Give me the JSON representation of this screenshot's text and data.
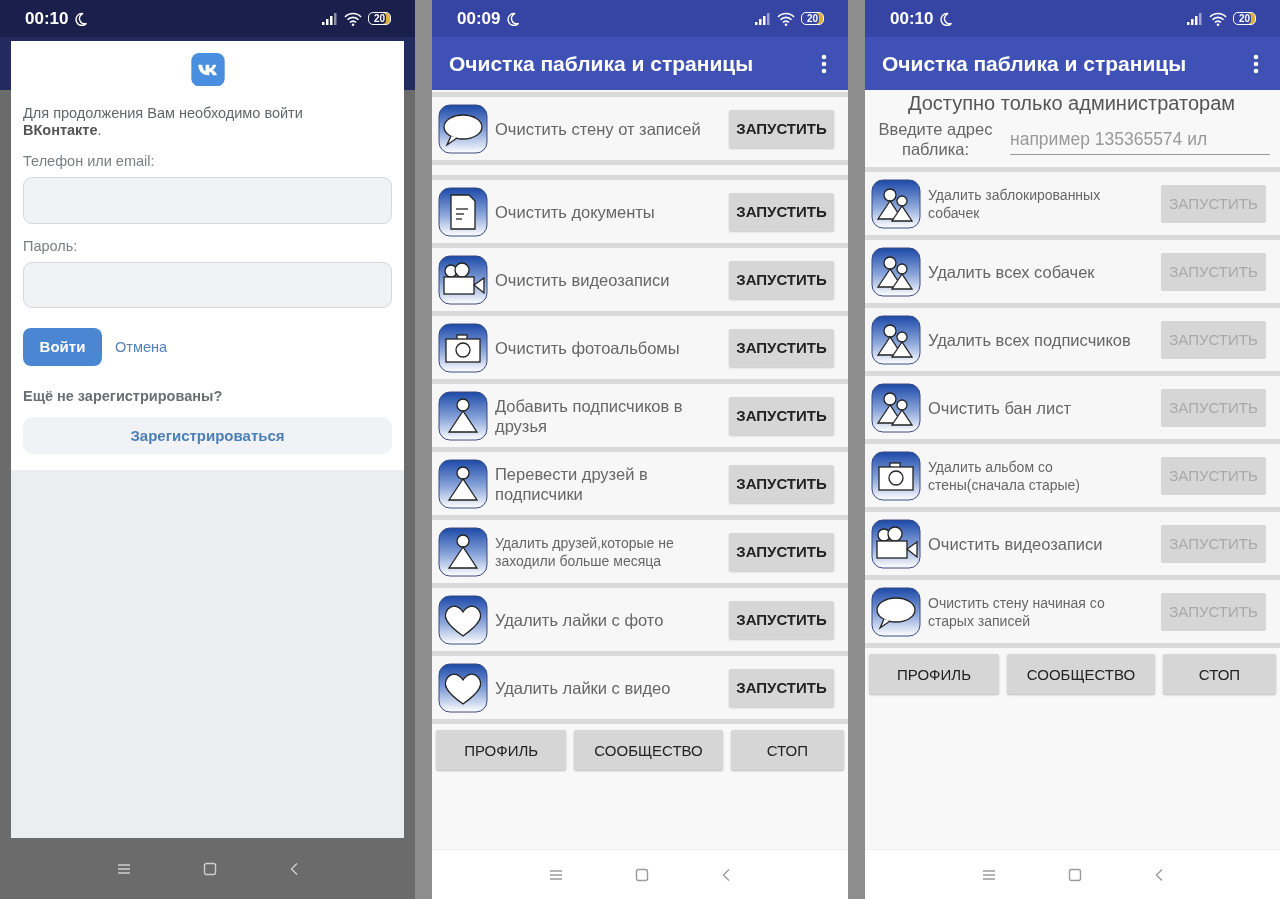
{
  "screens": [
    {
      "kind": "login",
      "status_bar": {
        "time": "00:10",
        "battery": "20"
      },
      "dialog": {
        "message": "Для продолжения Вам необходимо войти **ВКонтакте**.",
        "phone_label": "Телефон или email:",
        "password_label": "Пароль:",
        "login_button": "Войти",
        "cancel_link": "Отмена",
        "not_registered": "Ещё не зарегистрированы?",
        "register_button": "Зарегистрироваться"
      }
    },
    {
      "kind": "list",
      "status_bar": {
        "time": "00:09",
        "battery": "20"
      },
      "app_bar": {
        "title": "Очистка паблика и страницы"
      },
      "items": [
        {
          "kind": "chat",
          "label": "Очистить стену от записей",
          "button": {
            "label": "ЗАПУСТИТЬ",
            "disabled": false
          }
        },
        {
          "kind": "empty"
        },
        {
          "kind": "document",
          "label": "Очистить документы",
          "button": {
            "label": "ЗАПУСТИТЬ",
            "disabled": false
          }
        },
        {
          "kind": "video",
          "label": "Очистить видеозаписи",
          "button": {
            "label": "ЗАПУСТИТЬ",
            "disabled": false
          }
        },
        {
          "kind": "camera",
          "label": "Очистить фотоальбомы",
          "button": {
            "label": "ЗАПУСТИТЬ",
            "disabled": false
          }
        },
        {
          "kind": "person",
          "label": "Добавить подписчиков в друзья",
          "button": {
            "label": "ЗАПУСТИТЬ",
            "disabled": false
          }
        },
        {
          "kind": "person",
          "label": "Перевести друзей в подписчики",
          "button": {
            "label": "ЗАПУСТИТЬ",
            "disabled": false
          }
        },
        {
          "kind": "person",
          "label": "Удалить друзей,которые не заходили больше месяца",
          "button": {
            "label": "ЗАПУСТИТЬ",
            "disabled": false
          }
        },
        {
          "kind": "heart",
          "label": "Удалить лайки с фото",
          "button": {
            "label": "ЗАПУСТИТЬ",
            "disabled": false
          }
        },
        {
          "kind": "heart",
          "label": "Удалить лайки с видео",
          "button": {
            "label": "ЗАПУСТИТЬ",
            "disabled": false
          }
        }
      ],
      "bottom_buttons": [
        "ПРОФИЛЬ",
        "СООБЩЕСТВО",
        "СТОП"
      ]
    },
    {
      "kind": "list",
      "status_bar": {
        "time": "00:10",
        "battery": "20"
      },
      "app_bar": {
        "title": "Очистка паблика и страницы"
      },
      "admin_header": {
        "notice": "Доступно только администраторам",
        "address_label": "Введите адрес паблика:",
        "address_placeholder": "например 135365574 ил"
      },
      "items": [
        {
          "kind": "people",
          "label": "Удалить заблокированных собачек",
          "button": {
            "label": "ЗАПУСТИТЬ",
            "disabled": true
          }
        },
        {
          "kind": "people",
          "label": "Удалить всех собачек",
          "button": {
            "label": "ЗАПУСТИТЬ",
            "disabled": true
          }
        },
        {
          "kind": "people",
          "label": "Удалить всех подписчиков",
          "button": {
            "label": "ЗАПУСТИТЬ",
            "disabled": true
          }
        },
        {
          "kind": "people",
          "label": "Очистить бан лист",
          "button": {
            "label": "ЗАПУСТИТЬ",
            "disabled": true
          }
        },
        {
          "kind": "camera",
          "label": "Удалить альбом со стены(сначала старые)",
          "button": {
            "label": "ЗАПУСТИТЬ",
            "disabled": true
          }
        },
        {
          "kind": "video",
          "label": "Очистить видеозаписи",
          "button": {
            "label": "ЗАПУСТИТЬ",
            "disabled": true
          }
        },
        {
          "kind": "chat",
          "label": "Очистить стену начиная со старых записей",
          "button": {
            "label": "ЗАПУСТИТЬ",
            "disabled": true
          }
        }
      ],
      "bottom_buttons": [
        "ПРОФИЛЬ",
        "СООБЩЕСТВО",
        "СТОП"
      ]
    }
  ]
}
